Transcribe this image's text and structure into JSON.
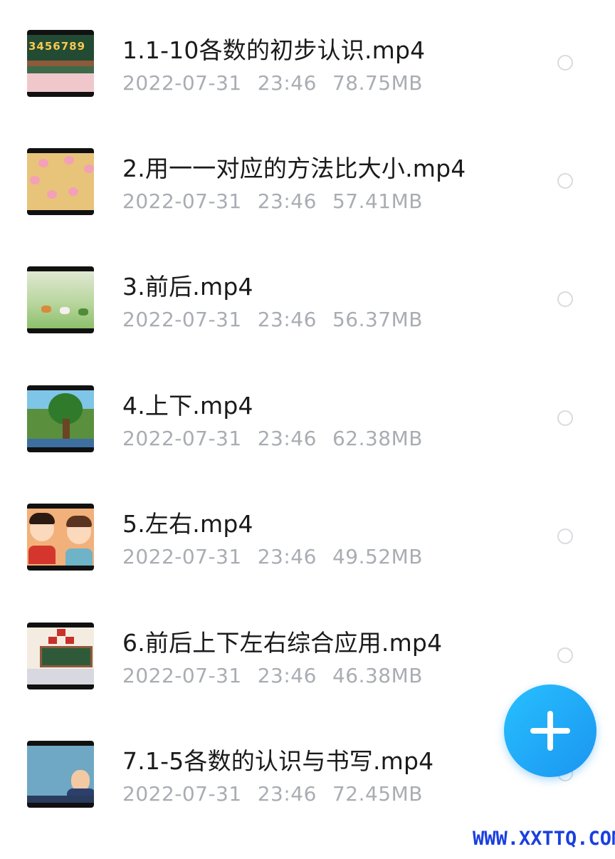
{
  "files": [
    {
      "title": "1.1-10各数的初步认识.mp4",
      "date": "2022-07-31",
      "time": "23:46",
      "size": "78.75MB",
      "thumb_text": "3456789"
    },
    {
      "title": "2.用一一对应的方法比大小.mp4",
      "date": "2022-07-31",
      "time": "23:46",
      "size": "57.41MB"
    },
    {
      "title": "3.前后.mp4",
      "date": "2022-07-31",
      "time": "23:46",
      "size": "56.37MB"
    },
    {
      "title": "4.上下.mp4",
      "date": "2022-07-31",
      "time": "23:46",
      "size": "62.38MB"
    },
    {
      "title": "5.左右.mp4",
      "date": "2022-07-31",
      "time": "23:46",
      "size": "49.52MB"
    },
    {
      "title": "6.前后上下左右综合应用.mp4",
      "date": "2022-07-31",
      "time": "23:46",
      "size": "46.38MB"
    },
    {
      "title": "7.1-5各数的认识与书写.mp4",
      "date": "2022-07-31",
      "time": "23:46",
      "size": "72.45MB"
    }
  ],
  "fab": {
    "icon": "plus-icon",
    "color": "#1b95f0"
  },
  "watermark": "WWW.XXTTQ.COM",
  "colors": {
    "title": "#1a1a1a",
    "meta": "#a9adb3",
    "radio": "#d9dbde",
    "watermark": "#1a3fe0"
  }
}
